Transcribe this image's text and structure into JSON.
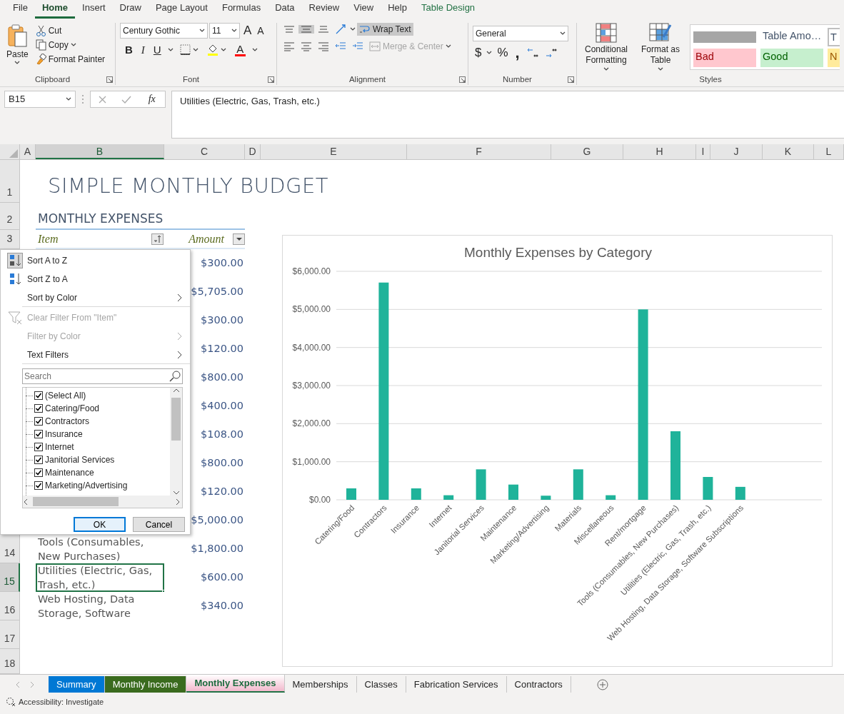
{
  "ribbon_tabs": [
    {
      "label": "File",
      "selected": false,
      "kind": "normal"
    },
    {
      "label": "Home",
      "selected": true,
      "kind": "normal"
    },
    {
      "label": "Insert",
      "selected": false,
      "kind": "normal"
    },
    {
      "label": "Draw",
      "selected": false,
      "kind": "normal"
    },
    {
      "label": "Page Layout",
      "selected": false,
      "kind": "normal"
    },
    {
      "label": "Formulas",
      "selected": false,
      "kind": "normal"
    },
    {
      "label": "Data",
      "selected": false,
      "kind": "normal"
    },
    {
      "label": "Review",
      "selected": false,
      "kind": "normal"
    },
    {
      "label": "View",
      "selected": false,
      "kind": "normal"
    },
    {
      "label": "Help",
      "selected": false,
      "kind": "normal"
    },
    {
      "label": "Table Design",
      "selected": false,
      "kind": "contextual"
    }
  ],
  "clipboard": {
    "label": "Clipboard",
    "paste": "Paste",
    "cut": "Cut",
    "copy": "Copy",
    "format_painter": "Format Painter"
  },
  "font": {
    "label": "Font",
    "name": "Century Gothic",
    "size": "11",
    "grow": "A",
    "shrink": "A",
    "bold": "B",
    "italic": "I",
    "underline": "U",
    "font_color": "A"
  },
  "alignment": {
    "label": "Alignment",
    "wrap_text": {
      "label": "Wrap Text",
      "on": true
    },
    "merge": {
      "label": "Merge & Center",
      "disabled": true
    }
  },
  "number": {
    "label": "Number",
    "format": "General",
    "currency": "$",
    "percent": "%",
    "comma": ","
  },
  "styles": {
    "label": "Styles",
    "conditional": "Conditional Formatting",
    "format_table": "Format as Table",
    "gallery": [
      {
        "kind": "bar"
      },
      {
        "kind": "title",
        "label": "Table Amo…"
      },
      {
        "kind": "outlined",
        "label": "T"
      },
      {
        "kind": "bad",
        "label": "Bad"
      },
      {
        "kind": "good",
        "label": "Good"
      },
      {
        "kind": "neutral",
        "label": "N"
      }
    ]
  },
  "formula_bar": {
    "name_box": "B15",
    "function_button": "fx",
    "formula": "Utilities (Electric, Gas, Trash, etc.)"
  },
  "columns": [
    {
      "label": "A",
      "selected": false
    },
    {
      "label": "B",
      "selected": true
    },
    {
      "label": "C",
      "selected": false
    },
    {
      "label": "D",
      "selected": false
    },
    {
      "label": "E",
      "selected": false
    },
    {
      "label": "F",
      "selected": false
    },
    {
      "label": "G",
      "selected": false
    },
    {
      "label": "H",
      "selected": false
    },
    {
      "label": "I",
      "selected": false
    },
    {
      "label": "J",
      "selected": false
    },
    {
      "label": "K",
      "selected": false
    },
    {
      "label": "L",
      "selected": false
    }
  ],
  "rows": [
    {
      "number": "1",
      "selected": false,
      "kind": "title",
      "text": "SIMPLE MONTHLY BUDGET"
    },
    {
      "number": "2",
      "selected": false,
      "kind": "section",
      "text": "MONTHLY EXPENSES"
    },
    {
      "number": "3",
      "selected": false,
      "kind": "header",
      "item": "Item",
      "item_sorted": true,
      "amount": "Amount",
      "amount_sorted": false
    },
    {
      "kind": "data",
      "amount": "$300.00"
    },
    {
      "kind": "data",
      "amount": "$5,705.00"
    },
    {
      "kind": "data",
      "amount": "$300.00"
    },
    {
      "kind": "data",
      "amount": "$120.00"
    },
    {
      "kind": "data",
      "amount": "$800.00"
    },
    {
      "kind": "data",
      "amount": "$400.00"
    },
    {
      "kind": "data",
      "amount": "$108.00"
    },
    {
      "kind": "data",
      "amount": "$800.00"
    },
    {
      "kind": "data",
      "amount": "$120.00"
    },
    {
      "kind": "data",
      "amount": "$5,000.00"
    },
    {
      "number": "14",
      "selected": false,
      "kind": "data",
      "item": "Tools (Consumables, New Purchases)",
      "amount": "$1,800.00"
    },
    {
      "number": "15",
      "selected": true,
      "kind": "data",
      "item": "Utilities (Electric, Gas, Trash, etc.)",
      "amount": "$600.00"
    },
    {
      "number": "16",
      "selected": false,
      "kind": "data",
      "item": "Web Hosting, Data Storage, Software",
      "amount": "$340.00"
    },
    {
      "number": "17",
      "selected": false,
      "kind": "empty"
    },
    {
      "number": "18",
      "selected": false,
      "kind": "empty"
    }
  ],
  "filter_menu": {
    "items": [
      {
        "label": "Sort A to Z",
        "kind": "sort-asc",
        "active": true,
        "disabled": false,
        "submenu": false,
        "separator_after": false
      },
      {
        "label": "Sort Z to A",
        "kind": "sort-desc",
        "active": false,
        "disabled": false,
        "submenu": false,
        "separator_after": false
      },
      {
        "label": "Sort by Color",
        "kind": "plain",
        "active": false,
        "disabled": false,
        "submenu": true,
        "separator_after": true
      },
      {
        "label": "Clear Filter From \"Item\"",
        "kind": "clear-filter",
        "active": false,
        "disabled": true,
        "submenu": false,
        "separator_after": false
      },
      {
        "label": "Filter by Color",
        "kind": "plain",
        "active": false,
        "disabled": true,
        "submenu": true,
        "separator_after": false
      },
      {
        "label": "Text Filters",
        "kind": "plain",
        "active": false,
        "disabled": false,
        "submenu": true,
        "separator_after": true
      }
    ],
    "search": {
      "placeholder": "Search"
    },
    "values": [
      {
        "label": "(Select All)",
        "checked": true
      },
      {
        "label": "Catering/Food",
        "checked": true
      },
      {
        "label": "Contractors",
        "checked": true
      },
      {
        "label": "Insurance",
        "checked": true
      },
      {
        "label": "Internet",
        "checked": true
      },
      {
        "label": "Janitorial Services",
        "checked": true
      },
      {
        "label": "Maintenance",
        "checked": true
      },
      {
        "label": "Marketing/Advertising",
        "checked": true
      }
    ],
    "buttons": [
      {
        "label": "OK",
        "default": true
      },
      {
        "label": "Cancel",
        "default": false
      }
    ]
  },
  "chart": {
    "chart_data": {
      "type": "bar",
      "title": "Monthly Expenses by Category",
      "categories": [
        "Catering/Food",
        "Contractors",
        "Insurance",
        "Internet",
        "Janitorial Services",
        "Maintenance",
        "Marketing/Advertising",
        "Materials",
        "Miscellaneous",
        "Rent/mortgage",
        "Tools (Consumables, New Purchases)",
        "Utilities (Electric, Gas, Trash, etc.)",
        "Web Hosting, Data Storage, Software Subscriptions"
      ],
      "series": [
        {
          "color": "#1fb39a",
          "values": [
            300,
            5705,
            300,
            120,
            800,
            400,
            108,
            800,
            120,
            5000,
            1800,
            600,
            340
          ]
        }
      ],
      "ylim": [
        0,
        6000
      ],
      "grid": true,
      "yticks": [
        {
          "value": 0,
          "label": "$0.00"
        },
        {
          "value": 1000,
          "label": "$1,000.00"
        },
        {
          "value": 2000,
          "label": "$2,000.00"
        },
        {
          "value": 3000,
          "label": "$3,000.00"
        },
        {
          "value": 4000,
          "label": "$4,000.00"
        },
        {
          "value": 5000,
          "label": "$5,000.00"
        },
        {
          "value": 6000,
          "label": "$6,000.00"
        }
      ]
    }
  },
  "sheet_tabs": [
    {
      "label": "Summary",
      "selected": false,
      "color": "#0078d4"
    },
    {
      "label": "Monthly Income",
      "selected": false,
      "color": "#3a6b1e"
    },
    {
      "label": "Monthly Expenses",
      "selected": true,
      "color": "#f2b8cc"
    },
    {
      "label": "Memberships",
      "selected": false
    },
    {
      "label": "Classes",
      "selected": false
    },
    {
      "label": "Fabrication Services",
      "selected": false
    },
    {
      "label": "Contractors",
      "selected": false
    }
  ],
  "status_bar": {
    "text": "Accessibility: Investigate"
  }
}
